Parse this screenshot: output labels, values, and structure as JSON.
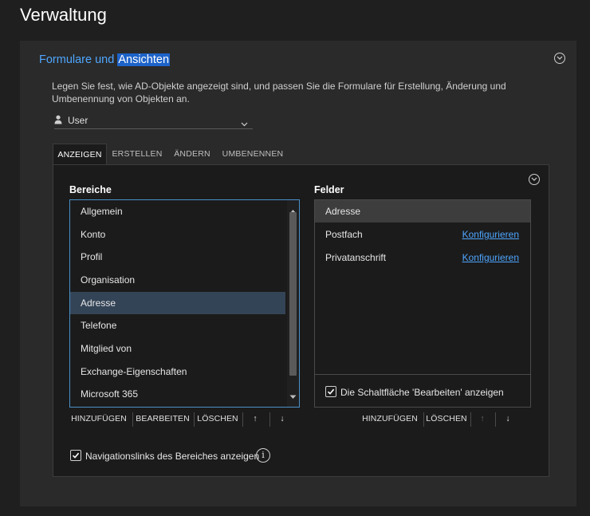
{
  "page": {
    "title": "Verwaltung"
  },
  "section": {
    "title_prefix": "Formulare und ",
    "title_highlight": "Ansichten",
    "description": "Legen Sie fest, wie AD-Objekte angezeigt sind, und passen Sie die Formulare für Erstellung, Änderung und Umbenennung von Objekten an.",
    "object_type": {
      "value": "User",
      "icon": "user-icon"
    }
  },
  "tabs": [
    {
      "label": "ANZEIGEN",
      "active": true
    },
    {
      "label": "ERSTELLEN",
      "active": false
    },
    {
      "label": "ÄNDERN",
      "active": false
    },
    {
      "label": "UMBENENNEN",
      "active": false
    }
  ],
  "bereiche": {
    "label": "Bereiche",
    "items": [
      {
        "label": "Allgemein",
        "selected": false
      },
      {
        "label": "Konto",
        "selected": false
      },
      {
        "label": "Profil",
        "selected": false
      },
      {
        "label": "Organisation",
        "selected": false
      },
      {
        "label": "Adresse",
        "selected": true
      },
      {
        "label": "Telefone",
        "selected": false
      },
      {
        "label": "Mitglied von",
        "selected": false
      },
      {
        "label": "Exchange-Eigenschaften",
        "selected": false
      },
      {
        "label": "Microsoft 365",
        "selected": false
      }
    ],
    "buttons": {
      "add": "HINZUFÜGEN",
      "edit": "BEARBEITEN",
      "delete": "LÖSCHEN",
      "up": "↑",
      "down": "↓"
    }
  },
  "felder": {
    "label": "Felder",
    "items": [
      {
        "label": "Adresse",
        "link": "",
        "selected": true
      },
      {
        "label": "Postfach",
        "link": "Konfigurieren",
        "selected": false
      },
      {
        "label": "Privatanschrift",
        "link": "Konfigurieren",
        "selected": false
      }
    ],
    "show_edit_button": {
      "label": "Die Schaltfläche 'Bearbeiten' anzeigen",
      "checked": true
    },
    "buttons": {
      "add": "HINZUFÜGEN",
      "delete": "LÖSCHEN",
      "up": "↑",
      "down": "↓"
    }
  },
  "nav_links": {
    "label": "Navigationslinks des Bereiches anzeigen",
    "checked": true,
    "info_symbol": "i"
  },
  "colors": {
    "accent": "#4ea6ff",
    "highlight": "#1d63c9",
    "selection": "#344457",
    "background": "#1f1f1f"
  }
}
